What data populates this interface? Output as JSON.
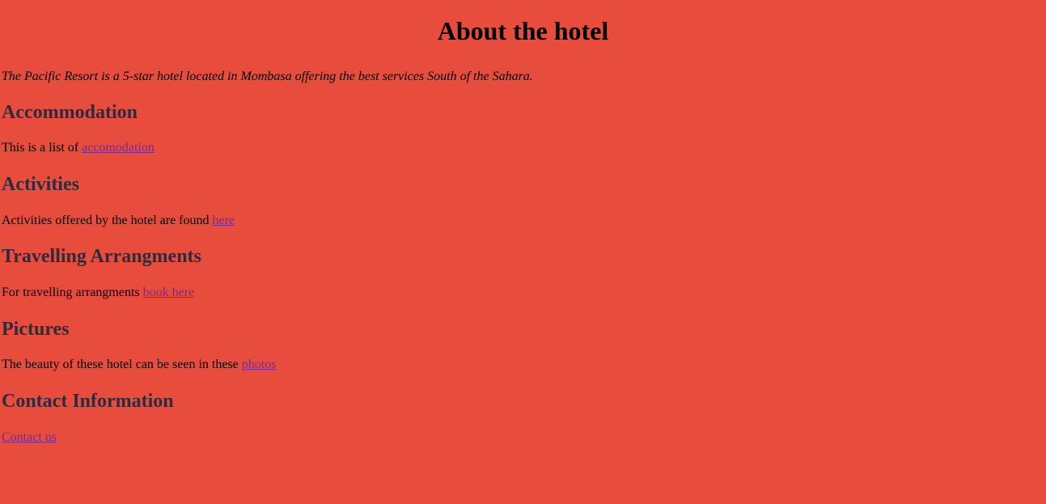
{
  "page": {
    "title": "About the hotel",
    "intro": "The Pacific Resort is a 5-star hotel located in Mombasa offering the best services South of the Sahara.",
    "background_color": "#e84c3d",
    "link_color": "#7b2a8e",
    "heading_color": "#2c2c3e"
  },
  "sections": {
    "accommodation": {
      "heading": "Accommodation",
      "text": "This is a list of ",
      "link": "accomodation"
    },
    "activities": {
      "heading": "Activities",
      "text": "Activities offered by the hotel are found ",
      "link": "here"
    },
    "travelling": {
      "heading": "Travelling Arrangments",
      "text": "For travelling arrangments ",
      "link": "book here"
    },
    "pictures": {
      "heading": "Pictures",
      "text": "The beauty of these hotel can be seen in these ",
      "link": "photos"
    },
    "contact": {
      "heading": "Contact Information",
      "link": "Contact us"
    }
  }
}
